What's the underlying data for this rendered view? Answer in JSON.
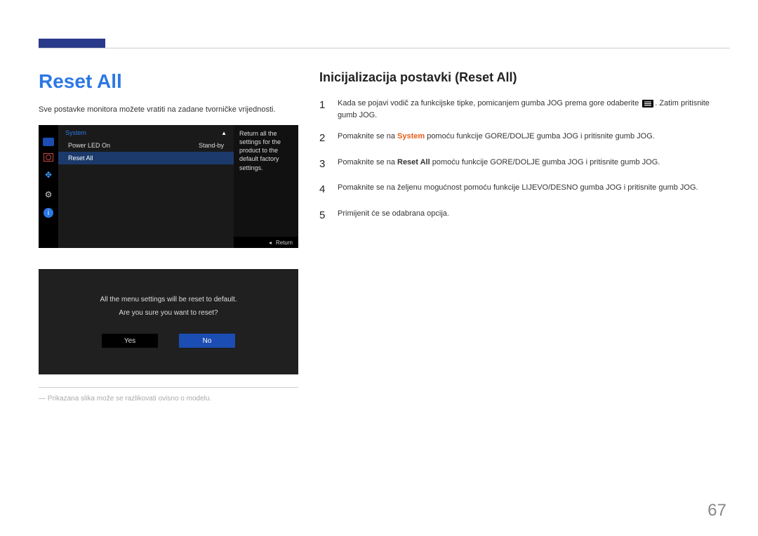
{
  "header": {
    "title": "Reset All"
  },
  "intro": "Sve postavke monitora možete vratiti na zadane tvorničke vrijednosti.",
  "osd": {
    "menu_title": "System",
    "rows": [
      {
        "label": "Power LED On",
        "value": "Stand-by"
      },
      {
        "label": "Reset All",
        "value": ""
      }
    ],
    "description": "Return all the settings for the product to the default factory settings.",
    "footer": "Return"
  },
  "dialog": {
    "line1": "All the menu settings will be reset to default.",
    "line2": "Are you sure you want to reset?",
    "yes": "Yes",
    "no": "No"
  },
  "footnote": "Prikazana slika može se razlikovati ovisno o modelu.",
  "section": {
    "title": "Inicijalizacija postavki (Reset All)",
    "steps": {
      "s1a": "Kada se pojavi vodič za funkcijske tipke, pomicanjem gumba JOG prema gore odaberite",
      "s1b": ". Zatim pritisnite gumb JOG.",
      "s2a": "Pomaknite se na ",
      "s2kw": "System",
      "s2b": " pomoću funkcije GORE/DOLJE gumba JOG i pritisnite gumb JOG.",
      "s3a": "Pomaknite se na ",
      "s3kw": "Reset All",
      "s3b": " pomoću funkcije GORE/DOLJE gumba JOG i pritisnite gumb JOG.",
      "s4": "Pomaknite se na željenu mogućnost pomoću funkcije LIJEVO/DESNO gumba JOG i pritisnite gumb JOG.",
      "s5": "Primijenit će se odabrana opcija."
    }
  },
  "page_number": "67"
}
